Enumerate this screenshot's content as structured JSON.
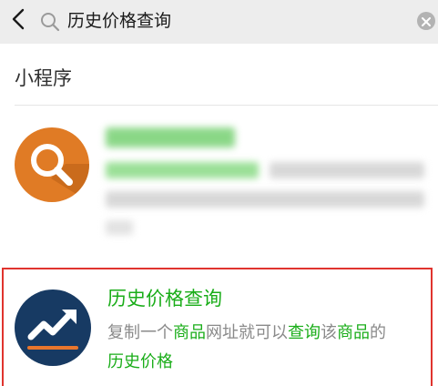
{
  "search": {
    "query": "历史价格查询"
  },
  "icons": {
    "back": "chevron-left-icon",
    "search": "search-icon",
    "clear": "clear-icon"
  },
  "section": {
    "title": "小程序"
  },
  "results": [
    {
      "blurred": true,
      "icon": "magnifier-icon",
      "icon_color": "#e07b25"
    },
    {
      "title": "历史价格查询",
      "desc_parts": [
        "复制一个",
        "商品",
        "网址就可以",
        "查询",
        "该",
        "商品",
        "的",
        "历史价格"
      ],
      "icon": "trend-chart-icon",
      "icon_color": "#173a63",
      "highlight_color": "#1aad19"
    }
  ]
}
